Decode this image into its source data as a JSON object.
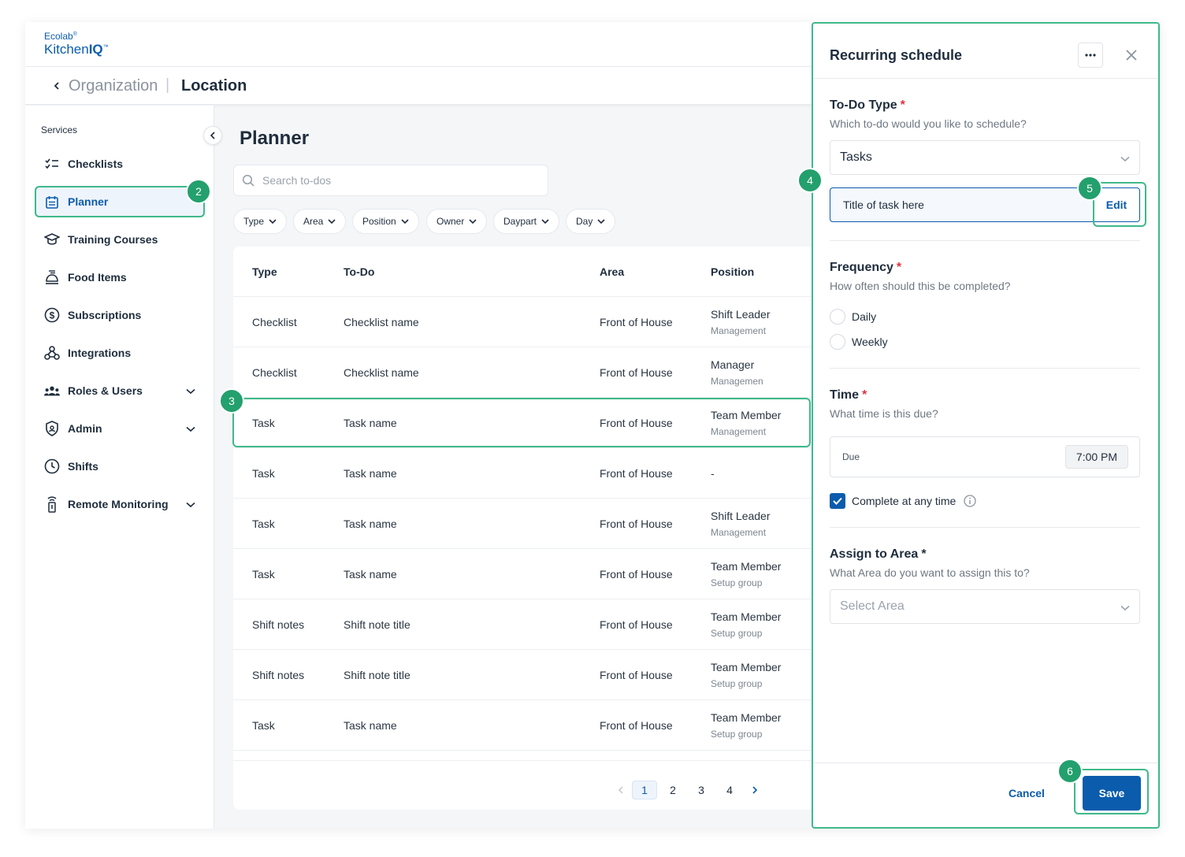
{
  "brand": {
    "line1": "Ecolab",
    "line1_mark": "®",
    "line2_a": "Kitchen",
    "line2_b": "IQ",
    "line2_mark": "™"
  },
  "breadcrumb": {
    "org": "Organization",
    "sep": "|",
    "location": "Location"
  },
  "sidebar": {
    "title": "Services",
    "items": [
      {
        "label": "Checklists",
        "icon": "checklist-icon"
      },
      {
        "label": "Planner",
        "icon": "calendar-icon",
        "active": true
      },
      {
        "label": "Training Courses",
        "icon": "graduation-cap-icon"
      },
      {
        "label": "Food Items",
        "icon": "food-tray-icon"
      },
      {
        "label": "Subscriptions",
        "icon": "dollar-circle-icon"
      },
      {
        "label": "Integrations",
        "icon": "webhook-icon"
      },
      {
        "label": "Roles & Users",
        "icon": "users-icon",
        "expandable": true
      },
      {
        "label": "Admin",
        "icon": "shield-icon",
        "expandable": true
      },
      {
        "label": "Shifts",
        "icon": "clock-icon"
      },
      {
        "label": "Remote Monitoring",
        "icon": "sensor-icon",
        "expandable": true
      }
    ]
  },
  "main": {
    "title": "Planner",
    "search_placeholder": "Search to-dos",
    "filters": [
      "Type",
      "Area",
      "Position",
      "Owner",
      "Daypart",
      "Day"
    ],
    "columns": [
      "Type",
      "To-Do",
      "Area",
      "Position"
    ],
    "rows": [
      {
        "type": "Checklist",
        "todo": "Checklist name",
        "area": "Front of House",
        "position": "Shift Leader",
        "group": "Management"
      },
      {
        "type": "Checklist",
        "todo": "Checklist name",
        "area": "Front of House",
        "position": "Manager",
        "group": "Managemen"
      },
      {
        "type": "Task",
        "todo": "Task name",
        "area": "Front of House",
        "position": "Team Member",
        "group": "Management"
      },
      {
        "type": "Task",
        "todo": "Task name",
        "area": "Front of House",
        "position": "-",
        "group": ""
      },
      {
        "type": "Task",
        "todo": "Task name",
        "area": "Front of House",
        "position": "Shift Leader",
        "group": "Management"
      },
      {
        "type": "Task",
        "todo": "Task name",
        "area": "Front of House",
        "position": "Team Member",
        "group": "Setup group"
      },
      {
        "type": "Shift notes",
        "todo": "Shift note title",
        "area": "Front of House",
        "position": "Team Member",
        "group": "Setup group"
      },
      {
        "type": "Shift notes",
        "todo": "Shift note title",
        "area": "Front of House",
        "position": "Team Member",
        "group": "Setup group"
      },
      {
        "type": "Task",
        "todo": "Task name",
        "area": "Front of House",
        "position": "Team Member",
        "group": "Setup group"
      }
    ],
    "pages": [
      "1",
      "2",
      "3",
      "4"
    ],
    "current_page": "1"
  },
  "panel": {
    "title": "Recurring schedule",
    "todo_type": {
      "label": "To-Do Type",
      "required": "*",
      "help": "Which to-do would you like to schedule?",
      "value": "Tasks"
    },
    "task_title": "Title of task here",
    "edit_label": "Edit",
    "frequency": {
      "label": "Frequency",
      "required": "*",
      "help": "How often should this be completed?",
      "options": [
        "Daily",
        "Weekly"
      ]
    },
    "time": {
      "label": "Time",
      "required": "*",
      "help": "What time is this due?",
      "due_label": "Due",
      "due_value": "7:00 PM"
    },
    "complete_any_time": "Complete at any time",
    "area": {
      "label": "Assign to Area",
      "required": "*",
      "help": "What Area do you want to assign this to?",
      "placeholder": "Select Area"
    },
    "cancel_label": "Cancel",
    "save_label": "Save"
  },
  "callouts": [
    "2",
    "3",
    "4",
    "5",
    "6"
  ],
  "colors": {
    "accent": "#0b5cad",
    "highlight": "#3fb98a",
    "badge": "#23a06d",
    "required": "#e0323c"
  }
}
